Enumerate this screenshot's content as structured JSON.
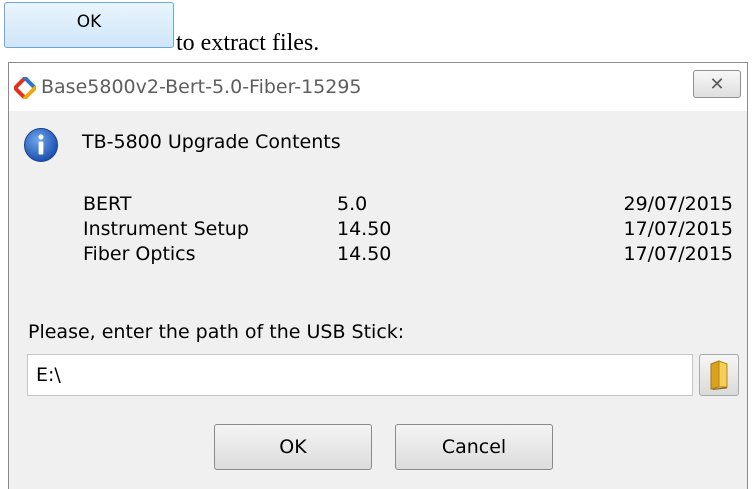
{
  "document": {
    "ok_label": "OK",
    "text": "to extract files."
  },
  "window": {
    "title": "Base5800v2-Bert-5.0-Fiber-15295",
    "close_glyph": "✕"
  },
  "dialog": {
    "heading": "TB-5800 Upgrade Contents",
    "items": [
      {
        "name": "BERT",
        "version": "5.0",
        "date": "29/07/2015"
      },
      {
        "name": "Instrument Setup",
        "version": "14.50",
        "date": "17/07/2015"
      },
      {
        "name": "Fiber Optics",
        "version": "14.50",
        "date": "17/07/2015"
      }
    ],
    "path_label": "Please, enter the path of the USB Stick:",
    "path_value": "E:\\",
    "ok_label": "OK",
    "cancel_label": "Cancel"
  },
  "icons": {
    "app": "diamond-logo-icon",
    "info": "info-icon",
    "browse": "folder-icon"
  },
  "colors": {
    "window_bg": "#f0f0f0",
    "info_blue": "#2d67c7",
    "top_button_border": "#6fa6d8"
  }
}
